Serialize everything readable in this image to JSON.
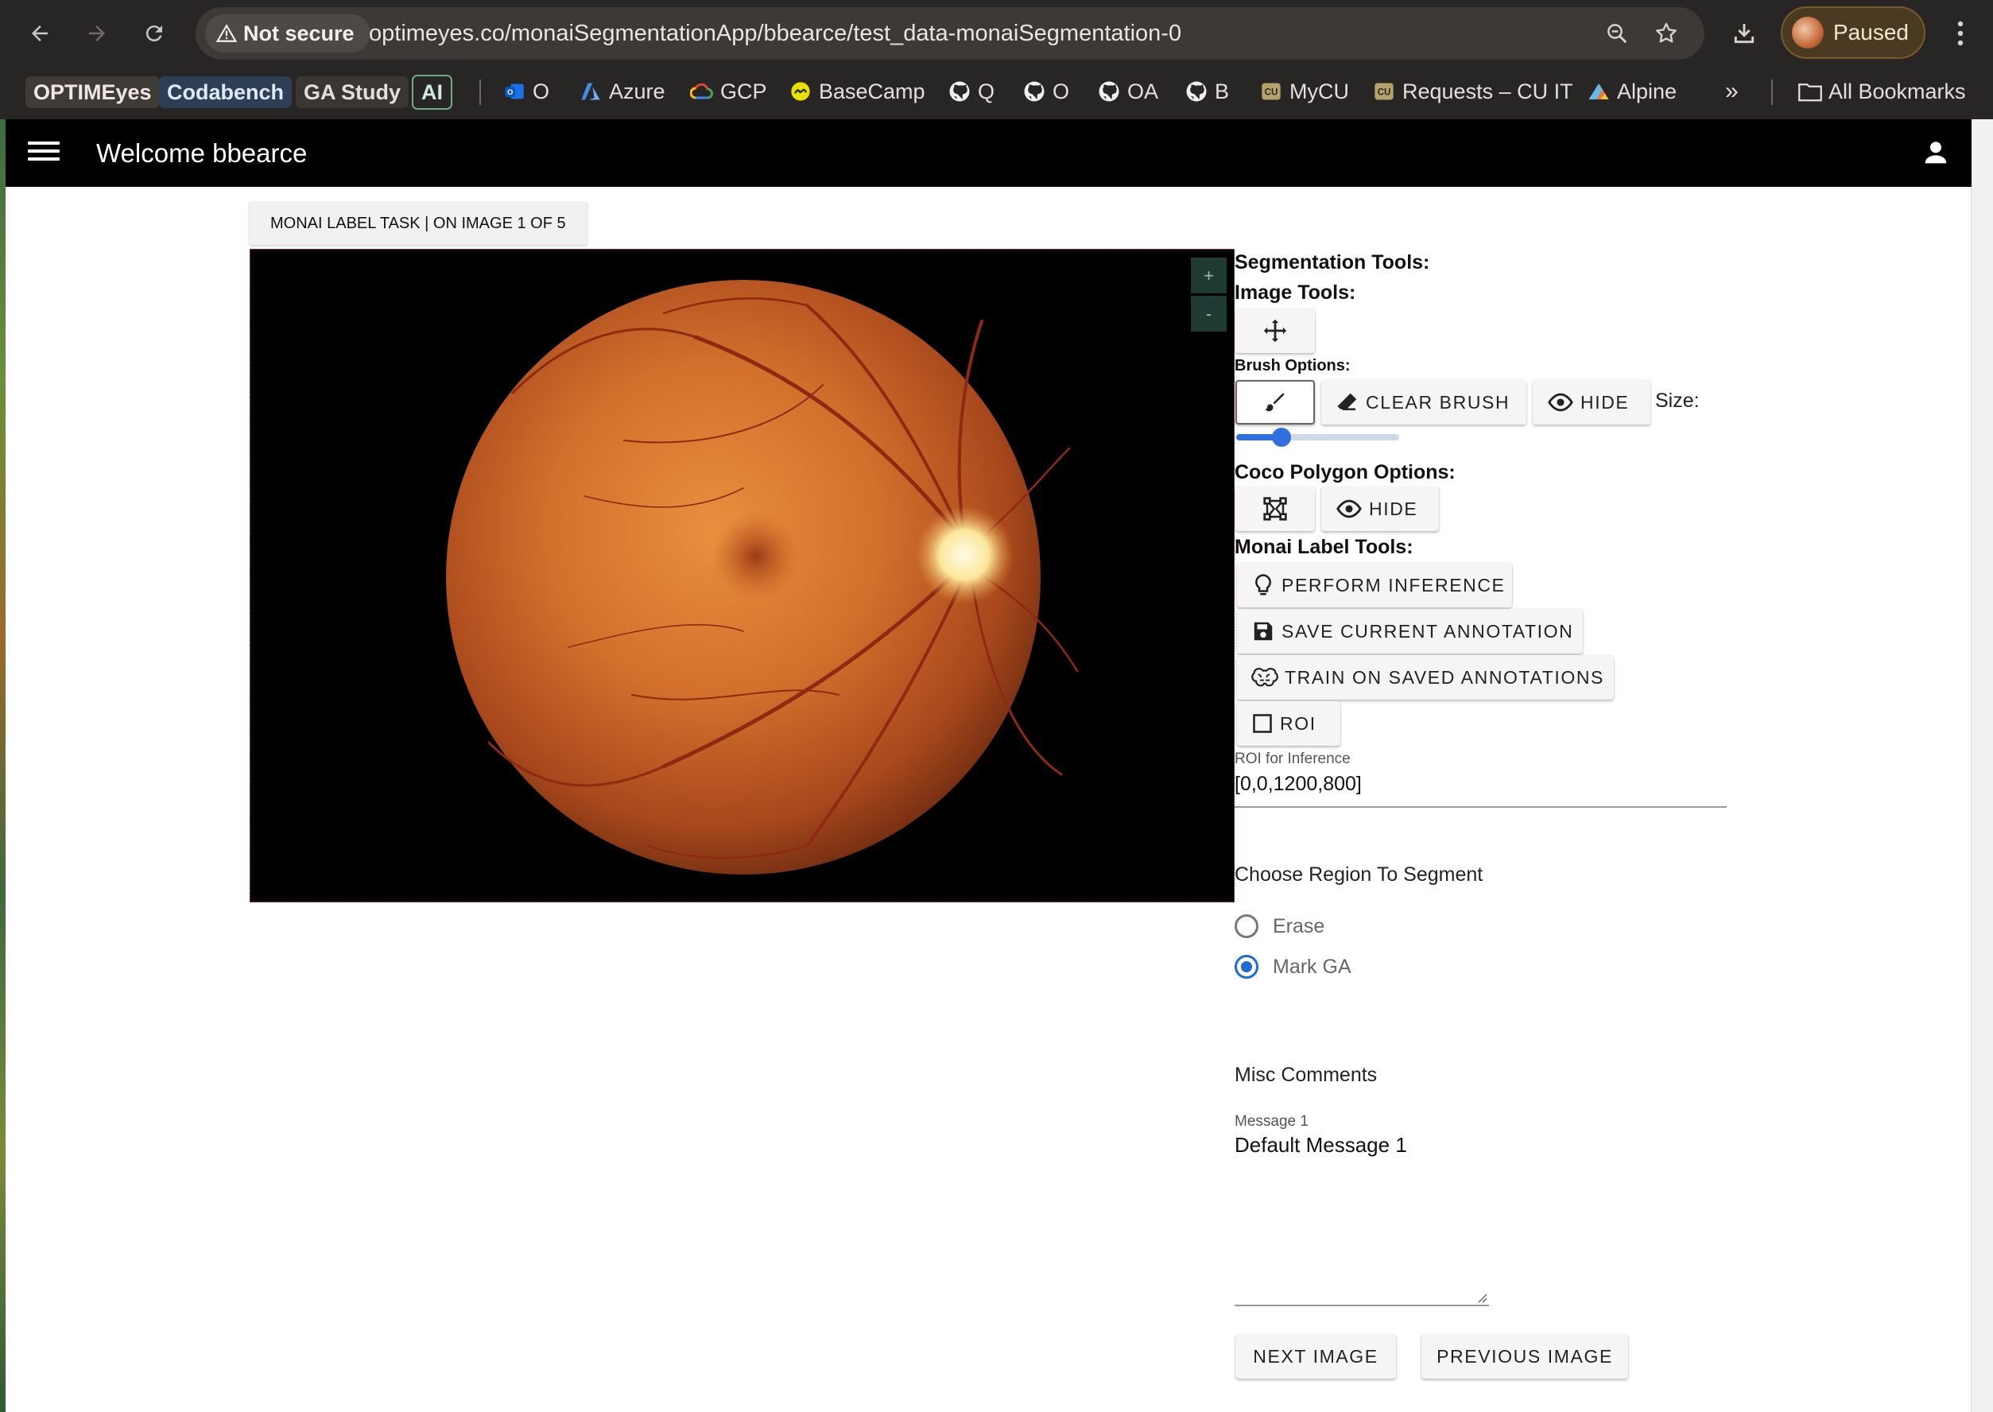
{
  "browser": {
    "security_label": "Not secure",
    "url": "optimeyes.co/monaiSegmentationApp/bbearce/test_data-monaiSegmentation-0",
    "profile_label": "Paused",
    "bookmarks": [
      {
        "label": "OPTIMEyes",
        "icon": "none"
      },
      {
        "label": "Codabench",
        "icon": "none"
      },
      {
        "label": "GA Study",
        "icon": "none"
      },
      {
        "label": "AI",
        "icon": "none"
      },
      {
        "label": "O",
        "icon": "outlook-icon"
      },
      {
        "label": "Azure",
        "icon": "azure-icon"
      },
      {
        "label": "GCP",
        "icon": "gcp-icon"
      },
      {
        "label": "BaseCamp",
        "icon": "basecamp-icon"
      },
      {
        "label": "Q",
        "icon": "github-icon"
      },
      {
        "label": "O",
        "icon": "github-icon"
      },
      {
        "label": "OA",
        "icon": "github-icon"
      },
      {
        "label": "B",
        "icon": "github-icon"
      },
      {
        "label": "MyCU",
        "icon": "cu-icon"
      },
      {
        "label": "Requests – CU IT",
        "icon": "cu-icon"
      },
      {
        "label": "Alpine",
        "icon": "alpine-icon"
      }
    ],
    "overflow_label": "»",
    "all_bookmarks_label": "All Bookmarks"
  },
  "appbar": {
    "title": "Welcome bbearce"
  },
  "task": {
    "tab_label": "MONAI LABEL TASK | ON IMAGE 1 OF 5"
  },
  "viewer": {
    "zoom_in_label": "+",
    "zoom_out_label": "-"
  },
  "tools": {
    "segmentation_title": "Segmentation Tools:",
    "image_tools_title": "Image Tools:",
    "brush_options_title": "Brush Options:",
    "clear_brush_label": "CLEAR BRUSH",
    "brush_hide_label": "HIDE",
    "size_label": "Size:",
    "brush_size_fraction": 0.28,
    "coco_title": "Coco Polygon Options:",
    "coco_hide_label": "HIDE",
    "monai_title": "Monai Label Tools:",
    "perform_inference_label": "PERFORM INFERENCE",
    "save_annotation_label": "SAVE CURRENT ANNOTATION",
    "train_label": "TRAIN ON SAVED ANNOTATIONS",
    "roi_label": "ROI",
    "roi_caption": "ROI for Inference",
    "roi_value": "[0,0,1200,800]"
  },
  "region": {
    "title": "Choose Region To Segment",
    "options": [
      {
        "label": "Erase",
        "checked": false
      },
      {
        "label": "Mark GA",
        "checked": true
      }
    ]
  },
  "comments": {
    "title": "Misc Comments",
    "message_caption": "Message 1",
    "message_value": "Default Message 1"
  },
  "nav": {
    "next_label": "NEXT IMAGE",
    "previous_label": "PREVIOUS IMAGE"
  },
  "colors": {
    "accent": "#1f6ad6",
    "appbar": "#000000",
    "chrome": "#282624"
  }
}
